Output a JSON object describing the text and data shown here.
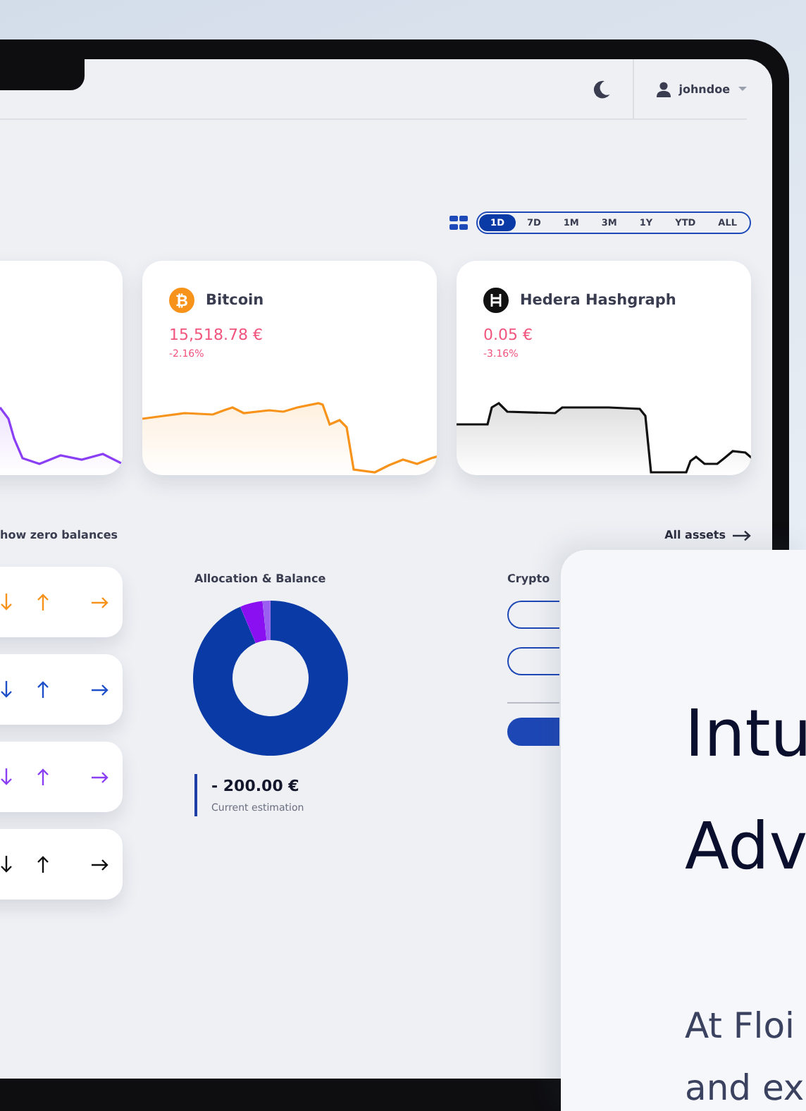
{
  "header": {
    "user": {
      "name": "johndoe"
    }
  },
  "timeframes": [
    {
      "label": "1D",
      "selected": true
    },
    {
      "label": "7D",
      "selected": false
    },
    {
      "label": "1M",
      "selected": false
    },
    {
      "label": "3M",
      "selected": false
    },
    {
      "label": "1Y",
      "selected": false
    },
    {
      "label": "YTD",
      "selected": false
    },
    {
      "label": "ALL",
      "selected": false
    }
  ],
  "asset_cards": [
    {
      "kind": "partial",
      "color": "#8b3ff5"
    },
    {
      "kind": "bitcoin",
      "symbol": "₿",
      "name": "Bitcoin",
      "price": "15,518.78 €",
      "change": "-2.16%",
      "color": "#f7931a"
    },
    {
      "kind": "hedera",
      "name": "Hedera Hashgraph",
      "price": "0.05 €",
      "change": "-3.16%",
      "color": "#111111"
    }
  ],
  "balances_toggle": {
    "label": "how zero balances"
  },
  "all_assets_link": {
    "label": "All assets"
  },
  "asset_rows": [
    {
      "color": "#f7931a"
    },
    {
      "color": "#1f4fc9"
    },
    {
      "color": "#8b3ff5"
    },
    {
      "color": "#111111"
    }
  ],
  "allocation": {
    "title": "Allocation & Balance",
    "amount": "- 200.00 €",
    "caption": "Current estimation"
  },
  "crypto": {
    "title": "Crypto",
    "buttons": [
      {
        "kind": "outline"
      },
      {
        "kind": "outline"
      },
      {
        "kind": "divider"
      },
      {
        "kind": "filled"
      }
    ]
  },
  "promo": {
    "heading": [
      "Intu",
      "Adv"
    ],
    "text": [
      "At Floi",
      "and ex"
    ]
  }
}
